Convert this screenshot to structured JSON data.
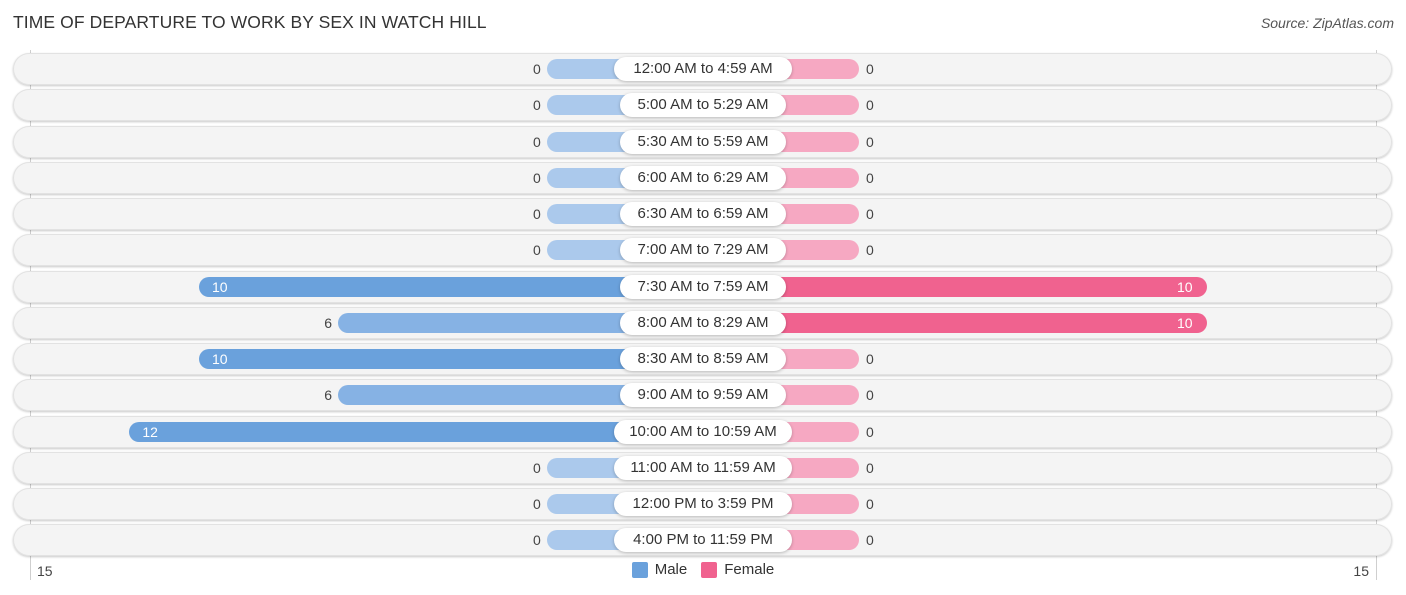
{
  "header": {
    "title": "TIME OF DEPARTURE TO WORK BY SEX IN WATCH HILL",
    "source": "Source: ZipAtlas.com"
  },
  "colors": {
    "male": "#6aa1dc",
    "male_light": "#abc9ec",
    "female": "#f0628f",
    "female_light": "#f6a8c2"
  },
  "chart_data": {
    "type": "bar",
    "orientation": "horizontal-diverging",
    "title": "TIME OF DEPARTURE TO WORK BY SEX IN WATCH HILL",
    "categories": [
      "12:00 AM to 4:59 AM",
      "5:00 AM to 5:29 AM",
      "5:30 AM to 5:59 AM",
      "6:00 AM to 6:29 AM",
      "6:30 AM to 6:59 AM",
      "7:00 AM to 7:29 AM",
      "7:30 AM to 7:59 AM",
      "8:00 AM to 8:29 AM",
      "8:30 AM to 8:59 AM",
      "9:00 AM to 9:59 AM",
      "10:00 AM to 10:59 AM",
      "11:00 AM to 11:59 AM",
      "12:00 PM to 3:59 PM",
      "4:00 PM to 11:59 PM"
    ],
    "series": [
      {
        "name": "Male",
        "values": [
          0,
          0,
          0,
          0,
          0,
          0,
          10,
          6,
          10,
          6,
          12,
          0,
          0,
          0
        ]
      },
      {
        "name": "Female",
        "values": [
          0,
          0,
          0,
          0,
          0,
          0,
          10,
          10,
          0,
          0,
          0,
          0,
          0,
          0
        ]
      }
    ],
    "xlim": [
      -15,
      15
    ],
    "axis_ticks": {
      "left": "15",
      "right": "15"
    },
    "legend": {
      "position": "bottom-center",
      "entries": [
        "Male",
        "Female"
      ]
    },
    "grid": false
  }
}
